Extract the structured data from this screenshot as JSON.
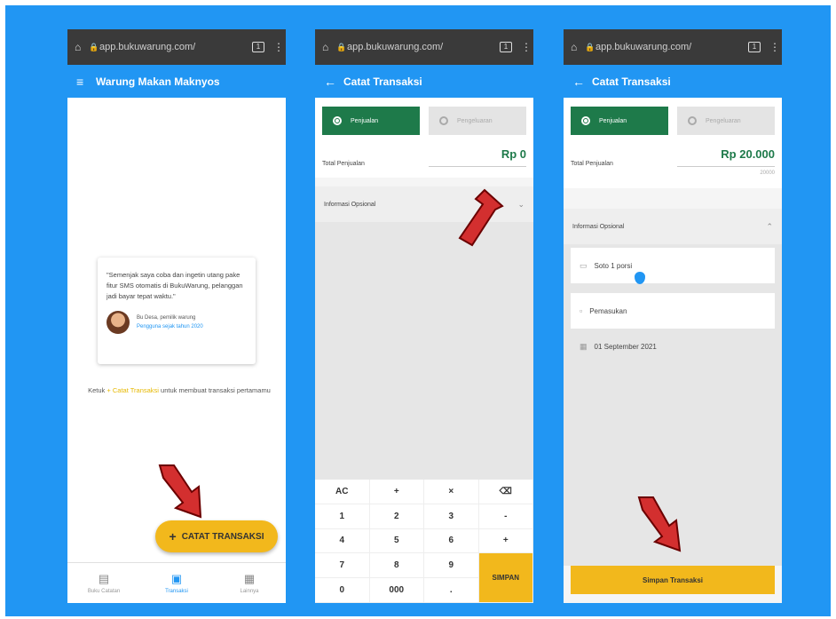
{
  "browser": {
    "url_short": "app.bukuwarung.com/",
    "tab_count": "1"
  },
  "screen1": {
    "title": "Warung Makan Maknyos",
    "quote": "\"Semenjak saya coba dan ingetin utang pake fitur SMS otomatis di BukuWarung, pelanggan jadi bayar tepat waktu.\"",
    "author_name": "Bu Desa, pemilik warung",
    "author_role": "Pengguna sejak tahun 2020",
    "hint_prefix": "Ketuk ",
    "hint_highlight": "+ Catat Transaksi",
    "hint_suffix": " untuk membuat transaksi pertamamu",
    "fab_label": "CATAT TRANSAKSI",
    "nav": [
      {
        "label": "Buku Catatan",
        "icon": "notebook-icon",
        "active": false
      },
      {
        "label": "Transaksi",
        "icon": "transaction-icon",
        "active": true
      },
      {
        "label": "Lainnya",
        "icon": "grid-icon",
        "active": false
      }
    ]
  },
  "screen2": {
    "title": "Catat Transaksi",
    "tab_sales": "Penjualan",
    "tab_expense": "Pengeluaran",
    "total_label": "Total Penjualan",
    "total_value": "Rp 0",
    "optional_label": "Informasi Opsional",
    "keys": [
      "AC",
      "+",
      "×",
      "⌫",
      "1",
      "2",
      "3",
      "-",
      "4",
      "5",
      "6",
      "+",
      "7",
      "8",
      "9",
      "0",
      "000",
      "."
    ],
    "save_key": "SIMPAN"
  },
  "screen3": {
    "title": "Catat Transaksi",
    "tab_sales": "Penjualan",
    "tab_expense": "Pengeluaran",
    "total_label": "Total Penjualan",
    "total_value": "Rp 20.000",
    "total_sub": "20000",
    "optional_label": "Informasi Opsional",
    "note_value": "Soto 1 porsi",
    "category_value": "Pemasukan",
    "date_value": "01 September 2021",
    "save_label": "Simpan Transaksi"
  },
  "colors": {
    "brand_blue": "#2196f3",
    "accent_yellow": "#f2b81c",
    "sales_green": "#1e7a4a",
    "arrow_red": "#d32f2f"
  }
}
